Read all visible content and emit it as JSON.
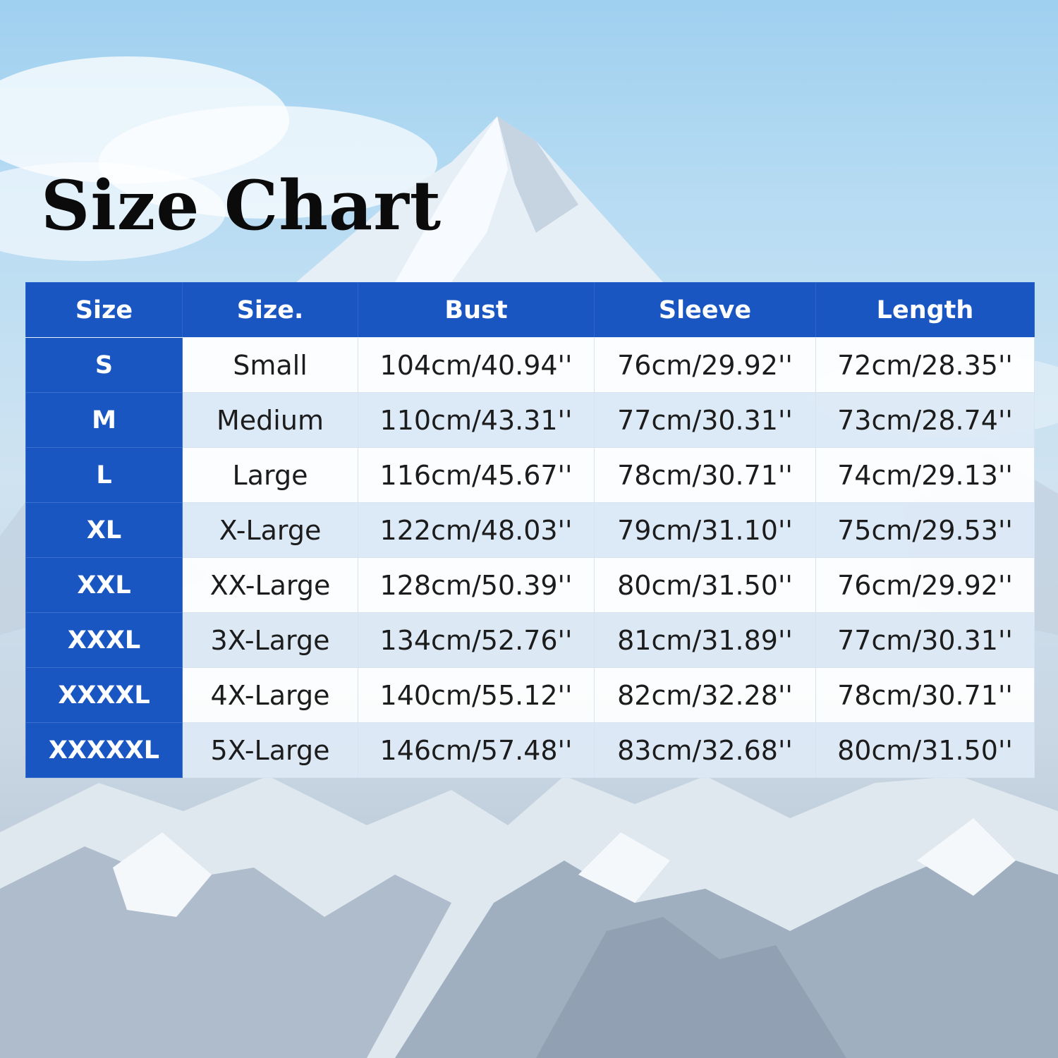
{
  "title": "Size Chart",
  "colors": {
    "header_blue": "#1a56c2",
    "sky": "#9fd0ef",
    "title_text": "#0b0b0b"
  },
  "table": {
    "headers": [
      "Size",
      "Size.",
      "Bust",
      "Sleeve",
      "Length"
    ],
    "rows": [
      [
        "S",
        "Small",
        "104cm/40.94''",
        "76cm/29.92''",
        "72cm/28.35''"
      ],
      [
        "M",
        "Medium",
        "110cm/43.31''",
        "77cm/30.31''",
        "73cm/28.74''"
      ],
      [
        "L",
        "Large",
        "116cm/45.67''",
        "78cm/30.71''",
        "74cm/29.13''"
      ],
      [
        "XL",
        "X-Large",
        "122cm/48.03''",
        "79cm/31.10''",
        "75cm/29.53''"
      ],
      [
        "XXL",
        "XX-Large",
        "128cm/50.39''",
        "80cm/31.50''",
        "76cm/29.92''"
      ],
      [
        "XXXL",
        "3X-Large",
        "134cm/52.76''",
        "81cm/31.89''",
        "77cm/30.31''"
      ],
      [
        "XXXXL",
        "4X-Large",
        "140cm/55.12''",
        "82cm/32.28''",
        "78cm/30.71''"
      ],
      [
        "XXXXXL",
        "5X-Large",
        "146cm/57.48''",
        "83cm/32.68''",
        "80cm/31.50''"
      ]
    ]
  }
}
